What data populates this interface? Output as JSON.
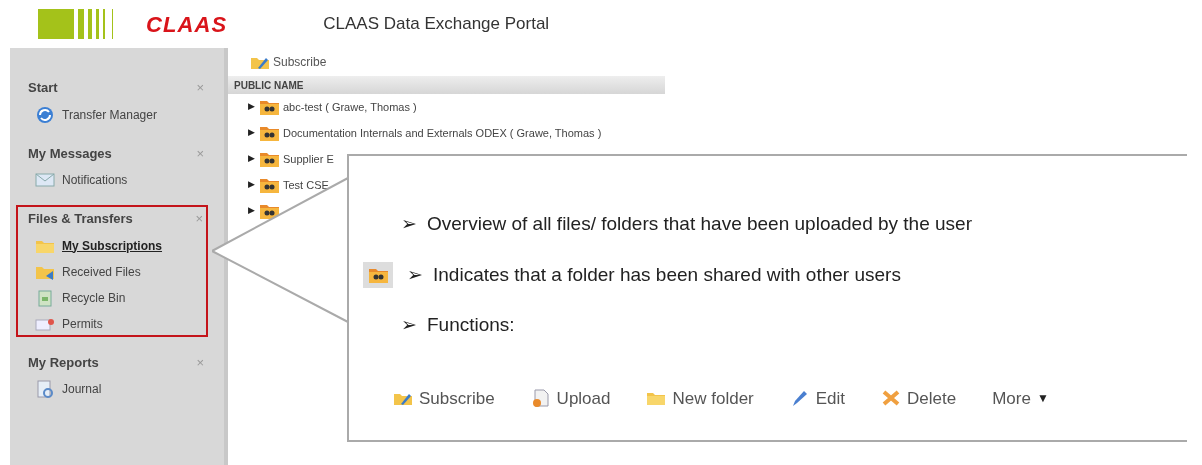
{
  "logo": {
    "text": "CLAAS"
  },
  "header": {
    "title": "CLAAS Data Exchange Portal"
  },
  "sidebar": {
    "sections": [
      {
        "title": "Start",
        "close": "×",
        "highlighted": false,
        "items": [
          {
            "label": "Transfer Manager",
            "kind": "globe",
            "selected": false
          }
        ]
      },
      {
        "title": "My Messages",
        "close": "×",
        "highlighted": false,
        "items": [
          {
            "label": "Notifications",
            "kind": "mail",
            "selected": false
          }
        ]
      },
      {
        "title": "Files & Transfers",
        "close": "×",
        "highlighted": true,
        "items": [
          {
            "label": "My Subscriptions",
            "kind": "folder",
            "selected": true
          },
          {
            "label": "Received Files",
            "kind": "received",
            "selected": false
          },
          {
            "label": "Recycle Bin",
            "kind": "bin",
            "selected": false
          },
          {
            "label": "Permits",
            "kind": "permit",
            "selected": false
          }
        ]
      },
      {
        "title": "My Reports",
        "close": "×",
        "highlighted": false,
        "items": [
          {
            "label": "Journal",
            "kind": "journal",
            "selected": false
          }
        ]
      }
    ]
  },
  "toolbar": {
    "buttons": [
      "Subscribe"
    ]
  },
  "table": {
    "columns": [
      "PUBLIC NAME"
    ],
    "rows": [
      {
        "expander": "▶",
        "name": "abc-test ( Grawe, Thomas )"
      },
      {
        "expander": "▶",
        "name": "Documentation Internals and Externals ODEX ( Grawe, Thomas )"
      },
      {
        "expander": "▶",
        "name": "Supplier E"
      },
      {
        "expander": "▶",
        "name": "Test CSE"
      },
      {
        "expander": "▶"
      }
    ]
  },
  "callout": {
    "bullets": [
      {
        "kind": "text",
        "marker": "➢",
        "text": "Overview of all files/ folders that have been uploaded by the user"
      },
      {
        "kind": "shared",
        "marker": "➢",
        "text": "Indicates that a folder has been shared with other users"
      },
      {
        "kind": "text",
        "marker": "➢",
        "text": "Functions:"
      }
    ],
    "functions": [
      {
        "label": "Subscribe",
        "kind": "subscribe"
      },
      {
        "label": "Upload",
        "kind": "upload"
      },
      {
        "label": "New folder",
        "kind": "folder"
      },
      {
        "label": "Edit",
        "kind": "edit"
      },
      {
        "label": "Delete",
        "kind": "delete"
      },
      {
        "label": "More",
        "kind": "menu",
        "caret": "▼"
      }
    ]
  }
}
